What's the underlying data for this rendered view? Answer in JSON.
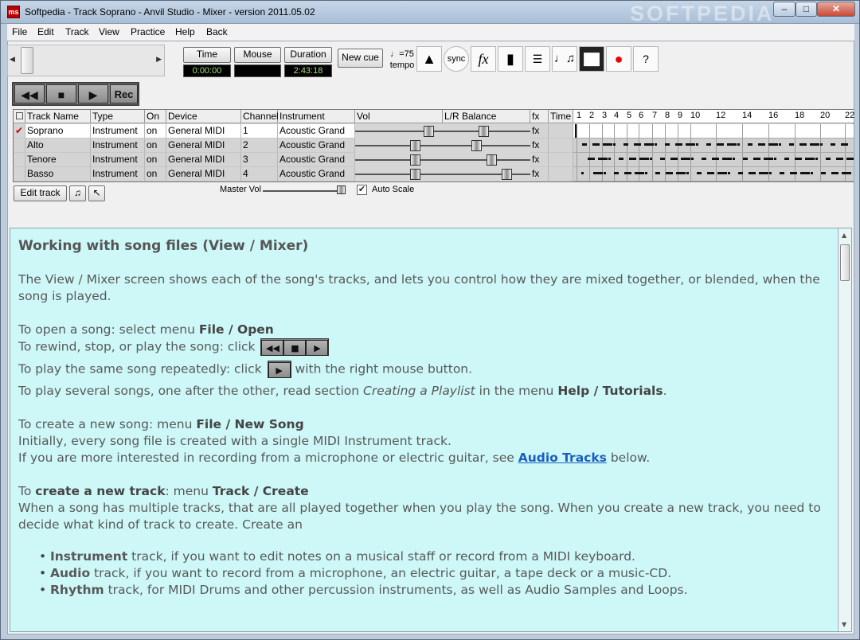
{
  "window": {
    "title": "Softpedia - Track Soprano - Anvil Studio - Mixer - version 2011.05.02",
    "watermark": "SOFTPEDIA",
    "min": "–",
    "max": "□",
    "close": "✕",
    "app_icon": "ms"
  },
  "menu": [
    "File",
    "Edit",
    "Track",
    "View",
    "Practice",
    "Help",
    "Back"
  ],
  "toolbar": {
    "time_label": "Time",
    "mouse_label": "Mouse",
    "duration_label": "Duration",
    "time_value": "0:00:00",
    "mouse_value": "",
    "duration_value": "2:43:18",
    "new_cue": "New cue",
    "tempo_top": "♩=75",
    "tempo_bottom": "tempo",
    "icons": [
      "metronome-icon",
      "sync-icon",
      "fx-icon",
      "microphone-icon",
      "mixer-icon",
      "speaker-icon",
      "keyboard-icon",
      "record-icon",
      "help-icon"
    ]
  },
  "transport": {
    "rewind": "◀◀",
    "stop": "■",
    "play": "▶",
    "rec": "Rec"
  },
  "grid": {
    "headers": {
      "check": "",
      "name": "Track Name",
      "type": "Type",
      "on": "On",
      "device": "Device",
      "channel": "Channel",
      "instrument": "Instrument",
      "vol": "Vol",
      "balance": "L/R Balance",
      "fx": "fx",
      "time": "Time"
    },
    "ruler": [
      "1",
      "2",
      "3",
      "4",
      "5",
      "6",
      "7",
      "8",
      "9",
      "10",
      "12",
      "14",
      "16",
      "18",
      "20",
      "22"
    ],
    "rows": [
      {
        "check": "✔",
        "name": "Soprano",
        "type": "Instrument",
        "on": "on",
        "device": "General MIDI",
        "channel": "1",
        "instrument": "Acoustic Grand",
        "fx": "fx",
        "vol": 0.9,
        "balance": 0.47
      },
      {
        "check": "",
        "name": "Alto",
        "type": "Instrument",
        "on": "on",
        "device": "General MIDI",
        "channel": "2",
        "instrument": "Acoustic Grand",
        "fx": "fx",
        "vol": 0.72,
        "balance": 0.37
      },
      {
        "check": "",
        "name": "Tenore",
        "type": "Instrument",
        "on": "on",
        "device": "General MIDI",
        "channel": "3",
        "instrument": "Acoustic Grand",
        "fx": "fx",
        "vol": 0.72,
        "balance": 0.57
      },
      {
        "check": "",
        "name": "Basso",
        "type": "Instrument",
        "on": "on",
        "device": "General MIDI",
        "channel": "4",
        "instrument": "Acoustic Grand",
        "fx": "fx",
        "vol": 0.72,
        "balance": 0.77
      }
    ]
  },
  "controls": {
    "edit_track": "Edit track",
    "master_vol": "Master Vol",
    "auto_scale": "Auto Scale",
    "auto_scale_checked": "✔"
  },
  "help": {
    "heading": "Working with song files (View / Mixer)",
    "p1a": "The View / Mixer screen shows each of the song's tracks, and lets you control how they are mixed together, or blended, when the",
    "p1b": "song is played.",
    "open_pre": "To open a song: select menu ",
    "open_b": "File / Open",
    "rewind": "To rewind, stop, or play the song: click",
    "repeat_pre": "To play the same song repeatedly: click",
    "repeat_post": " with the right mouse button.",
    "several_pre": "To play several songs, one after the other, read section ",
    "several_i": "Creating a Playlist",
    "several_mid": " in the menu ",
    "several_b": "Help / Tutorials",
    "several_end": ".",
    "new_pre": "To create a new song: menu ",
    "new_b": "File / New Song",
    "initially": "Initially, every song file is created with a single MIDI Instrument track.",
    "mic_pre": "If you are more interested in recording from a microphone or electric guitar, see ",
    "mic_link": "Audio Tracks",
    "mic_post": " below.",
    "track_pre": "To ",
    "track_b1": "create a new track",
    "track_mid": ": menu ",
    "track_b2": "Track / Create",
    "multi_a": "When a song has multiple tracks, that are all played together when you play the song. When you create a new track, you need to",
    "multi_b": "decide what kind of track to create. Create an",
    "b1_b": "Instrument",
    "b1": " track, if you want to edit notes on a musical staff or record from a MIDI keyboard.",
    "b2_b": "Audio",
    "b2": " track, if you want to record from a microphone, an electric guitar, a tape deck or a music-CD.",
    "b3_b": "Rhythm",
    "b3": " track, for MIDI Drums and other percussion instruments, as well as Audio Samples and Loops."
  }
}
